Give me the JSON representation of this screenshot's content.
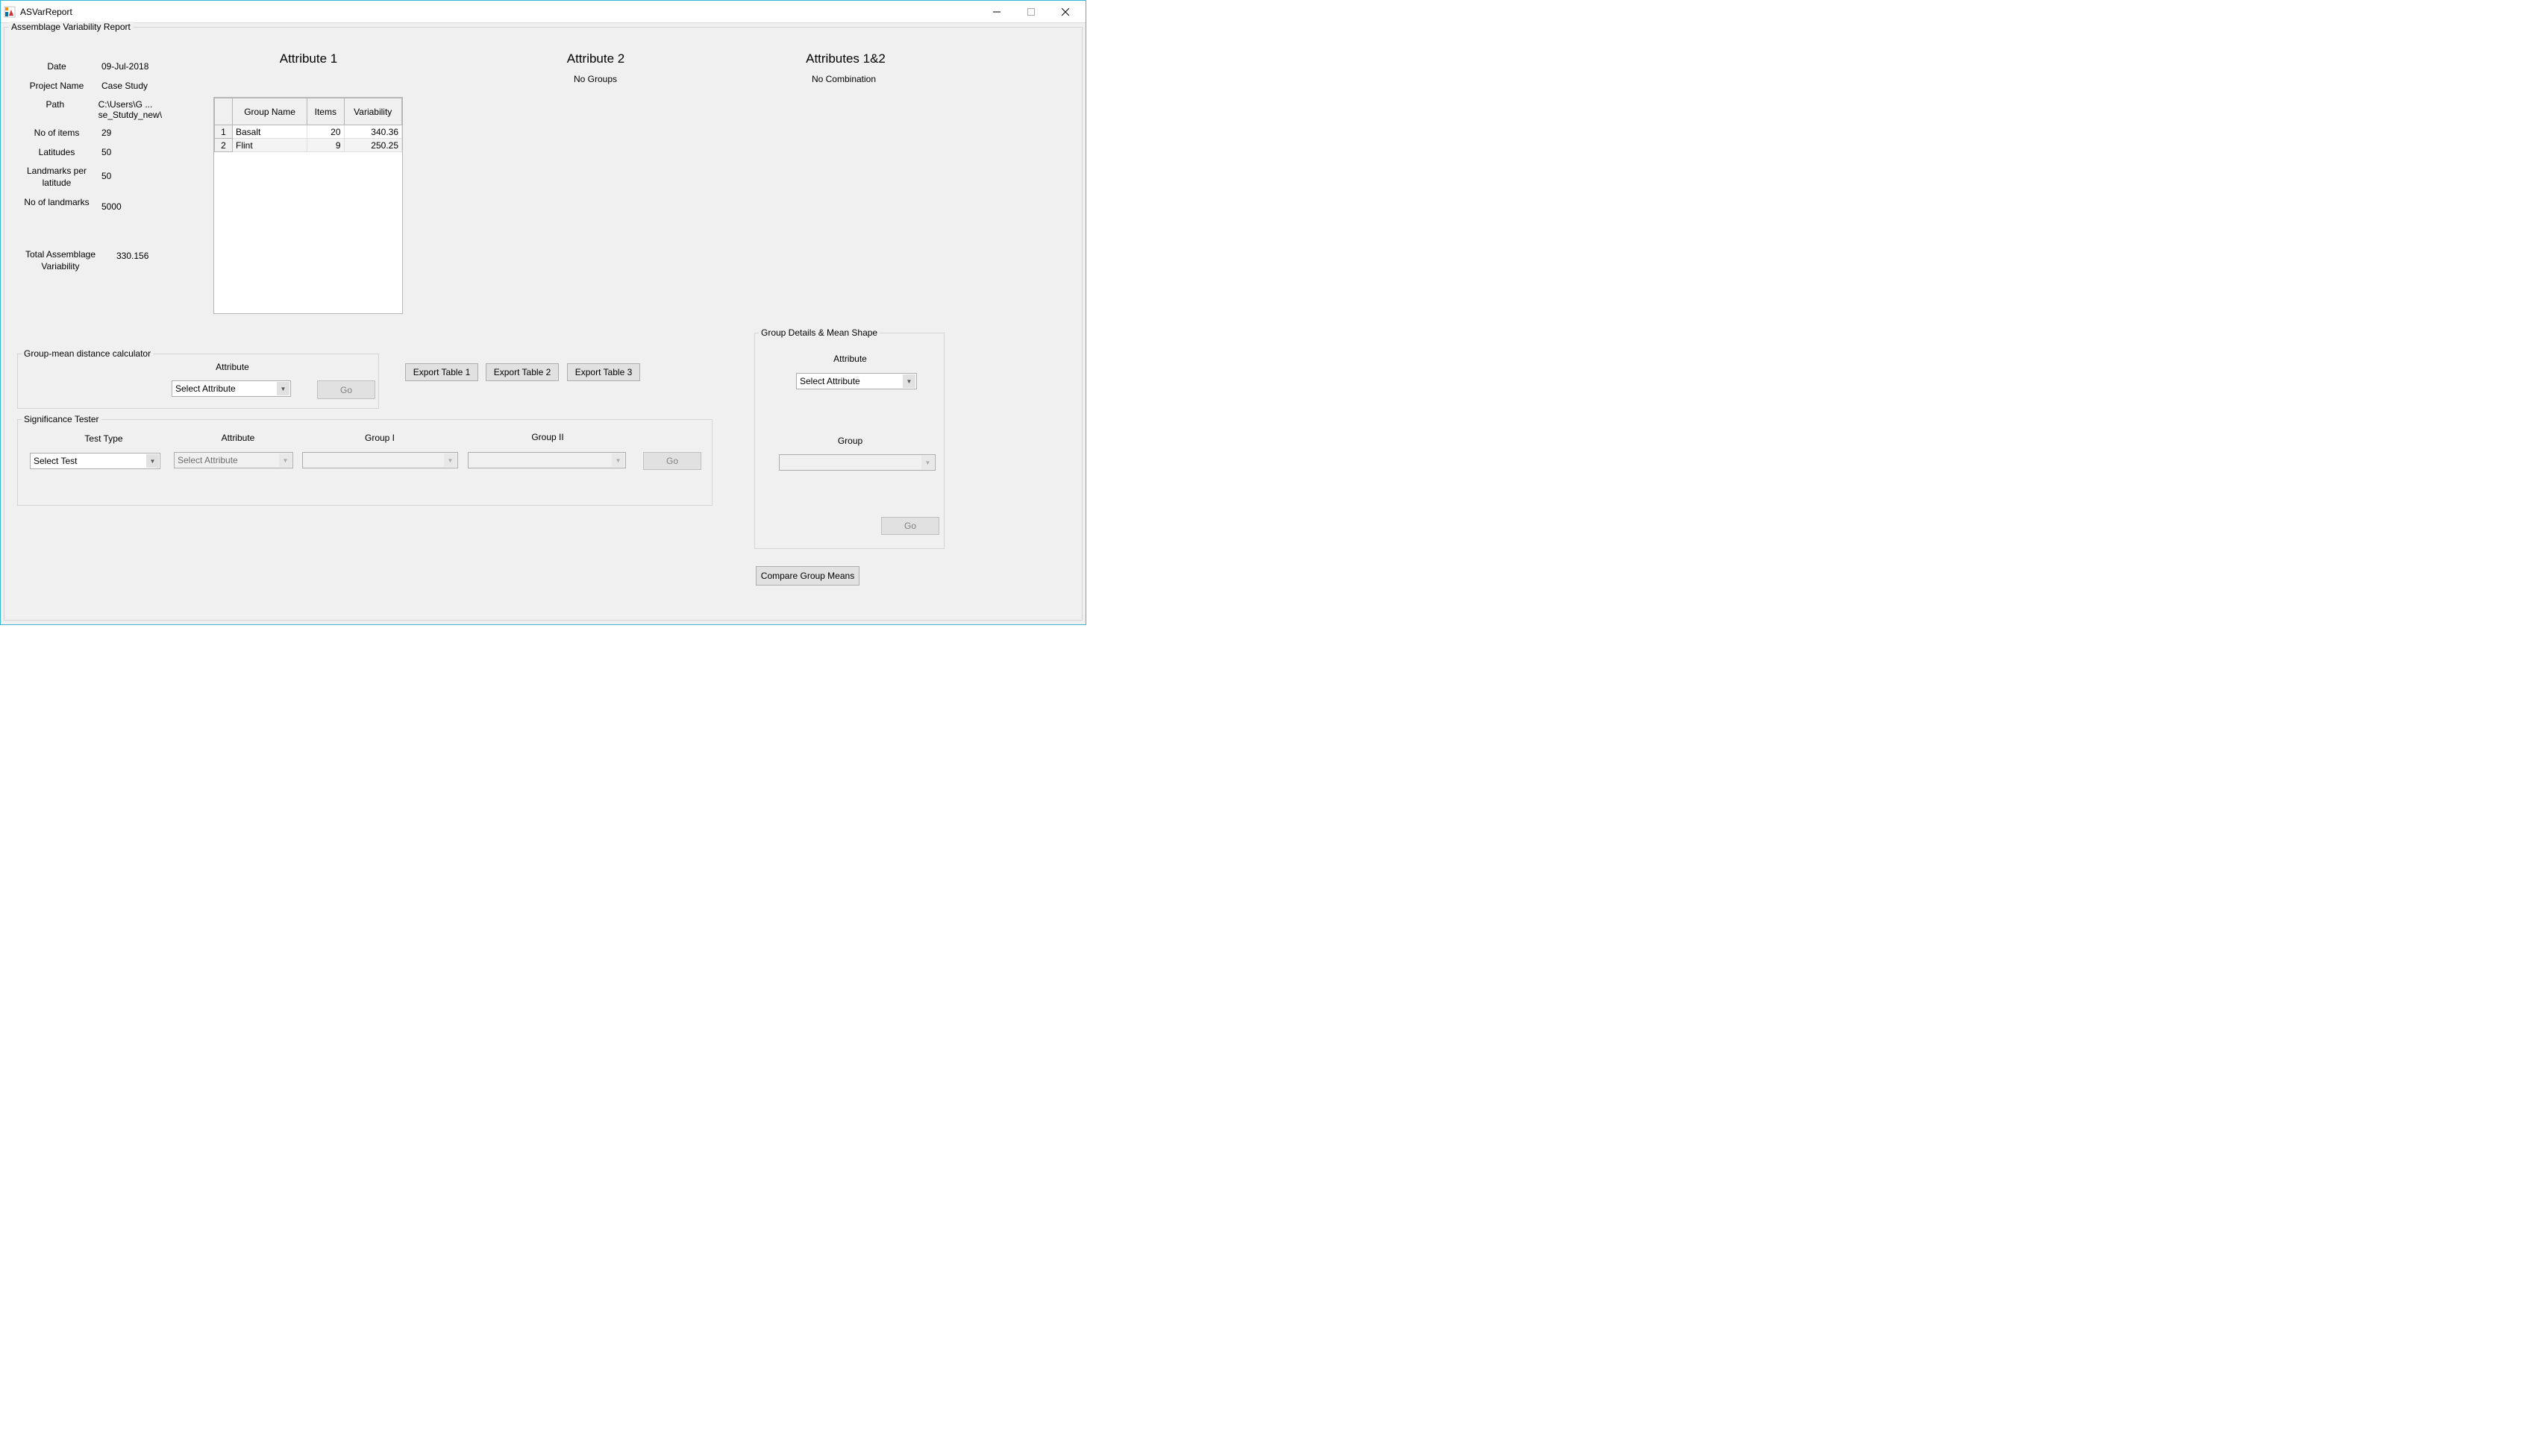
{
  "window": {
    "title": "ASVarReport"
  },
  "main_frame_title": "Assemblage Variability Report",
  "meta": {
    "date_label": "Date",
    "date_value": "09-Jul-2018",
    "project_label": "Project Name",
    "project_value": "Case Study",
    "path_label": "Path",
    "path_value": "C:\\Users\\G ... se_Stutdy_new\\",
    "items_label": "No of items",
    "items_value": "29",
    "latitudes_label": "Latitudes",
    "latitudes_value": "50",
    "lpl_label": "Landmarks per latitude",
    "lpl_value": "50",
    "landmarks_label": "No of landmarks",
    "landmarks_value": "5000",
    "total_var_label": "Total Assemblage Variability",
    "total_var_value": "330.156"
  },
  "attributes": {
    "attr1_heading": "Attribute 1",
    "attr2_heading": "Attribute 2",
    "attr12_heading": "Attributes 1&2",
    "attr2_sub": "No Groups",
    "attr12_sub": "No Combination"
  },
  "table": {
    "col_group": "Group Name",
    "col_items": "Items",
    "col_var": "Variability",
    "rows": [
      {
        "idx": "1",
        "name": "Basalt",
        "items": "20",
        "var": "340.36"
      },
      {
        "idx": "2",
        "name": "Flint",
        "items": "9",
        "var": "250.25"
      }
    ]
  },
  "group_mean": {
    "title": "Group-mean distance calculator",
    "attr_label": "Attribute",
    "select_placeholder": "Select Attribute",
    "go": "Go"
  },
  "sig_tester": {
    "title": "Significance Tester",
    "test_type_label": "Test Type",
    "attr_label": "Attribute",
    "g1_label": "Group I",
    "g2_label": "Group II",
    "test_placeholder": "Select Test",
    "attr_placeholder": "Select Attribute",
    "go": "Go"
  },
  "group_details": {
    "title": "Group Details & Mean Shape",
    "attr_label": "Attribute",
    "attr_placeholder": "Select Attribute",
    "group_label": "Group",
    "go": "Go"
  },
  "buttons": {
    "export1": "Export Table 1",
    "export2": "Export Table 2",
    "export3": "Export Table 3",
    "compare": "Compare Group Means"
  }
}
